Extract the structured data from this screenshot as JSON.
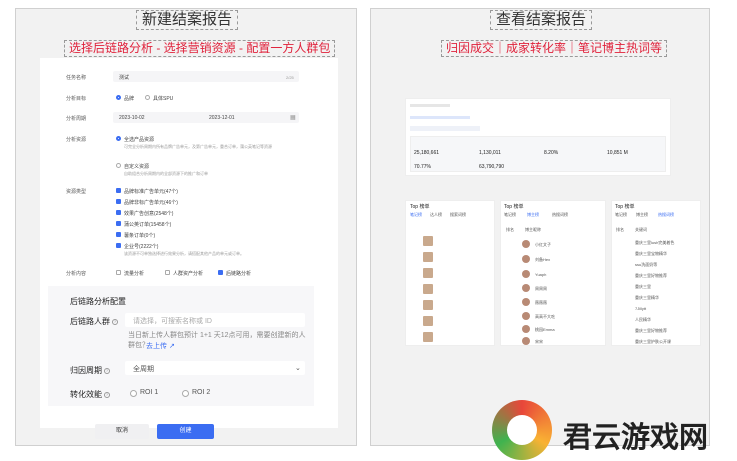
{
  "left": {
    "title": "新建结案报告",
    "subtitle": "选择后链路分析 - 选择营销资源 - 配置一方人群包",
    "form": {
      "task_name_label": "任务名称",
      "task_name_value": "测试",
      "task_name_count": "2/25",
      "target_label": "分析目标",
      "target_opt1": "品牌",
      "target_opt2": "具体SPU",
      "period_label": "分析周期",
      "period_start": "2023-10-02",
      "period_end": "2023-12-01",
      "resource_label": "分析资源",
      "resource_opt1": "全选产品资源",
      "resource_opt1_hint": "可完全分析周期内所有品牌广告单元，及第广告单元，重合订单，蒲公英笔记等资源",
      "resource_opt2": "自定义资源",
      "resource_opt2_hint": "自助组合分析周期内的全部资源下的推广和订单",
      "resource_type_label": "资源类型",
      "types": [
        "品牌标准广告单元(47个)",
        "品牌非标广告单元(46个)",
        "效果广告创意(2548个)",
        "蒲公英订单(15458个)",
        "薯条订单(0个)",
        "企业号(2222个)"
      ],
      "types_hint": "该资源不可单独选择进行效果分析，请搭配其他产品的单元或订单。",
      "content_label": "分析内容",
      "content_opt1": "流量分析",
      "content_opt2": "人群资产分析",
      "content_opt3": "后链路分析"
    },
    "config": {
      "heading": "后链路分析配置",
      "crowd_label": "后链路人群",
      "crowd_placeholder": "请选择，可搜索名称或 ID",
      "crowd_hint": "当日新上传人群包预计 1+1 天12点可用，需要创建新的人群包？",
      "upload_link": "去上传",
      "attr_label": "归因周期",
      "attr_value": "全周期",
      "conv_label": "转化效能",
      "roi1": "ROI 1",
      "roi2": "ROI 2"
    },
    "buttons": {
      "cancel": "取消",
      "create": "创建"
    }
  },
  "right": {
    "title": "查看结案报告",
    "subtitle": "归因成交｜成家转化率｜笔记博主热词等",
    "summary": {
      "values": [
        "25,180,661",
        "1,130,011",
        "8.20%",
        "10,851 M",
        "70.77%",
        "63,790,790"
      ]
    },
    "top_cards": [
      {
        "title": "Top 榜单",
        "tabs": [
          "笔记榜",
          "达人榜",
          "搜索词榜"
        ]
      },
      {
        "title": "Top 榜单",
        "tabs": [
          "笔记榜",
          "博主榜",
          "热搜词榜"
        ],
        "col1": "排名",
        "col2": "博主昵称",
        "rows": [
          "小红文子",
          "刘备Hex",
          "Yuaph",
          "周周周",
          "薇薇薇",
          "高高不大吃",
          "桃园Emma",
          "宋宋"
        ]
      },
      {
        "title": "Top 榜单",
        "tabs": [
          "笔记榜",
          "博主榜",
          "热搜词榜"
        ],
        "col1": "排名",
        "col2": "关键词",
        "rows": [
          "重庆三里lush完美着色",
          "重庆三里宝物精华",
          "ssu洗面奶等",
          "重庆三里好物推荐",
          "重庆三里",
          "重庆三里精华",
          "7Jillytt",
          "人民精华",
          "重庆三里好物推荐",
          "重庆三里护肤公开课"
        ]
      }
    ]
  },
  "watermark": {
    "brand": "君云游戏网"
  },
  "colors": {
    "accent": "#3b6df2",
    "subtitle": "#e0223b"
  }
}
